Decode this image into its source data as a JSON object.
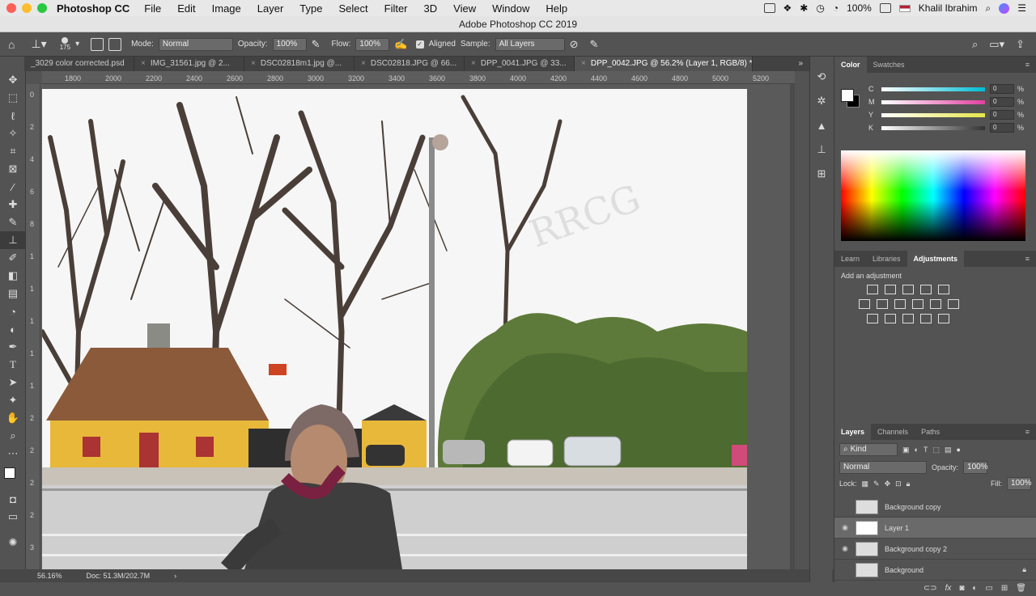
{
  "menubar": {
    "app_name": "Photoshop CC",
    "menus": [
      "File",
      "Edit",
      "Image",
      "Layer",
      "Type",
      "Select",
      "Filter",
      "3D",
      "View",
      "Window",
      "Help"
    ],
    "battery": "100%",
    "user": "Khalil Ibrahim"
  },
  "window": {
    "title": "Adobe Photoshop CC 2019"
  },
  "options": {
    "brush_size": "175",
    "mode_label": "Mode:",
    "mode_value": "Normal",
    "opacity_label": "Opacity:",
    "opacity_value": "100%",
    "flow_label": "Flow:",
    "flow_value": "100%",
    "aligned_label": "Aligned",
    "sample_label": "Sample:",
    "sample_value": "All Layers"
  },
  "tabs": [
    {
      "label": "_3029 color corrected.psd"
    },
    {
      "label": "IMG_31561.jpg @ 2..."
    },
    {
      "label": "DSC02818m1.jpg @..."
    },
    {
      "label": "DSC02818.JPG @ 66..."
    },
    {
      "label": "DPP_0041.JPG @ 33..."
    },
    {
      "label": "DPP_0042.JPG @ 56.2% (Layer 1, RGB/8) *"
    }
  ],
  "ruler": {
    "h_ticks": [
      "1800",
      "2000",
      "2200",
      "2400",
      "2600",
      "2800",
      "3000",
      "3200",
      "3400",
      "3600",
      "3800",
      "4000",
      "4200",
      "4400",
      "4600",
      "4800",
      "5000",
      "5200"
    ],
    "v_ticks": [
      "0",
      "2",
      "4",
      "6",
      "8",
      "1",
      "1",
      "1",
      "1",
      "1",
      "2",
      "2",
      "2",
      "2",
      "3"
    ]
  },
  "status": {
    "zoom": "56.16%",
    "doc": "Doc: 51.3M/202.7M"
  },
  "color_panel": {
    "tabs": [
      "Color",
      "Swatches"
    ],
    "channels": [
      {
        "label": "C",
        "value": "0",
        "unit": "%",
        "color": "#00bcd4"
      },
      {
        "label": "M",
        "value": "0",
        "unit": "%",
        "color": "#e040a0"
      },
      {
        "label": "Y",
        "value": "0",
        "unit": "%",
        "color": "#e6e64a"
      },
      {
        "label": "K",
        "value": "0",
        "unit": "%",
        "color": "#888888"
      }
    ]
  },
  "adjustments_panel": {
    "tabs": [
      "Learn",
      "Libraries",
      "Adjustments"
    ],
    "hint": "Add an adjustment"
  },
  "layers_panel": {
    "tabs": [
      "Layers",
      "Channels",
      "Paths"
    ],
    "filter": "Kind",
    "blend": "Normal",
    "opacity_label": "Opacity:",
    "opacity": "100%",
    "lock_label": "Lock:",
    "fill_label": "Fill:",
    "fill": "100%",
    "layers": [
      {
        "name": "Background copy",
        "visible": false
      },
      {
        "name": "Layer 1",
        "visible": true
      },
      {
        "name": "Background copy 2",
        "visible": true
      },
      {
        "name": "Background",
        "visible": false
      }
    ]
  },
  "watermark": "RRCG"
}
